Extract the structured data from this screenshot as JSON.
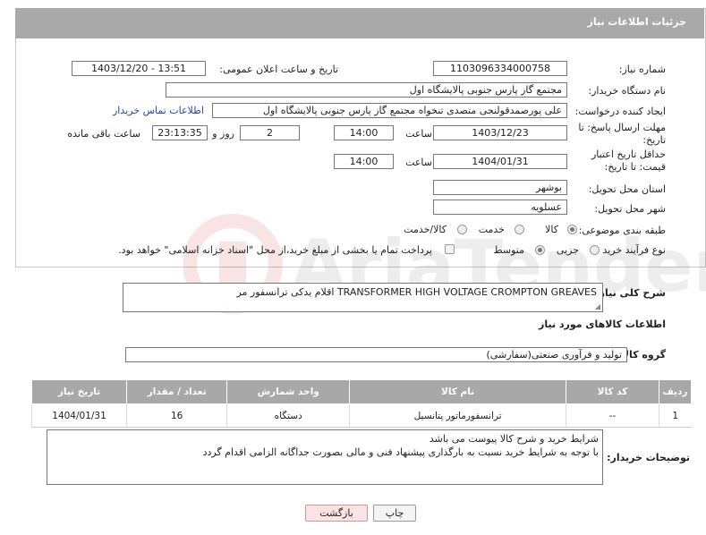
{
  "header": {
    "title": "جزئیات اطلاعات نیاز"
  },
  "form": {
    "need_number_label": "شماره نیاز:",
    "need_number": "1103096334000758",
    "announce_label": "تاریخ و ساعت اعلان عمومی:",
    "announce_value": "1403/12/20 - 13:51",
    "buyer_org_label": "نام دستگاه خریدار:",
    "buyer_org": "مجتمع گاز پارس جنوبی  پالایشگاه اول",
    "requester_label": "ایجاد کننده درخواست:",
    "requester": "علی پورصمدقولنجی متصدی تنخواه مجتمع گاز پارس جنوبی  پالایشگاه اول",
    "contact_link": "اطلاعات تماس خریدار",
    "reply_deadline_label": "مهلت ارسال پاسخ: تا تاریخ:",
    "reply_date": "1403/12/23",
    "time_label": "ساعت",
    "reply_time": "14:00",
    "days_count": "2",
    "days_label": "روز و",
    "remaining_time": "23:13:35",
    "remaining_label": "ساعت باقی مانده",
    "price_validity_label": "حداقل تاریخ اعتبار قیمت: تا تاریخ:",
    "price_date": "1404/01/31",
    "price_time": "14:00",
    "province_label": "استان محل تحویل:",
    "province": "بوشهر",
    "city_label": "شهر محل تحویل:",
    "city": "عسلویه",
    "category_label": "طبقه بندی موضوعی:",
    "category_options": [
      "کالا",
      "خدمت",
      "کالا/خدمت"
    ],
    "process_label": "نوع فرآیند خرید :",
    "process_options": [
      "جزیی",
      "متوسط"
    ],
    "payment_note": "پرداخت تمام یا بخشی از مبلغ خرید،از محل \"اسناد خزانه اسلامی\" خواهد بود."
  },
  "description": {
    "label": "شرح کلی نیاز:",
    "text": "اقلام یدکی ترانسفور مر TRANSFORMER HIGH VOLTAGE CROMPTON GREAVES"
  },
  "goods": {
    "section_title": "اطلاعات کالاهای مورد نیاز",
    "group_label": "گروه کالا:",
    "group_value": "تولید و فرآوری صنعتی(سفارشی)",
    "columns": [
      "ردیف",
      "کد کالا",
      "نام کالا",
      "واحد شمارش",
      "تعداد / مقدار",
      "تاریخ نیاز"
    ],
    "rows": [
      {
        "row": "1",
        "code": "--",
        "name": "ترانسفورماتور پتانسیل",
        "unit": "دستگاه",
        "qty": "16",
        "date": "1404/01/31"
      }
    ]
  },
  "buyer_notes": {
    "label": "توضیحات خریدار:",
    "line1": "شرایط خرید و شرح کالا  پیوست می باشد",
    "line2": "با توجه به شرایط خرید نسبت به بارگذاری پیشنهاد فنی و مالی بصورت جداگانه الزامی اقدام گردد"
  },
  "buttons": {
    "print": "چاپ",
    "back": "بازگشت"
  },
  "watermark": {
    "text": "AriaTender.neT"
  }
}
